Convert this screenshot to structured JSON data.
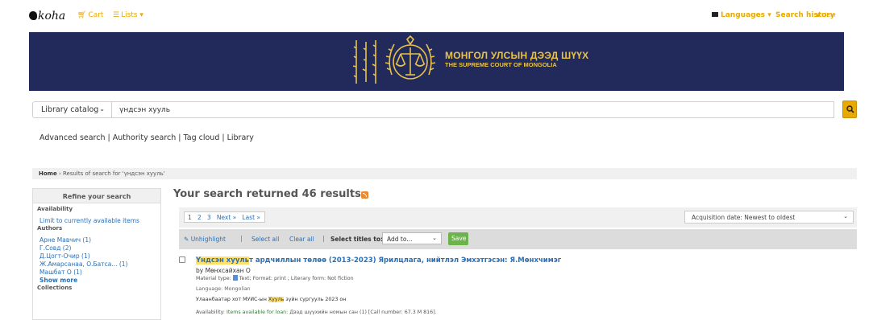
{
  "navbar": {
    "logo": "koha",
    "cart": "Cart",
    "lists": "Lists",
    "languages": "Languages",
    "search_history": "Search history",
    "clear": "Clear"
  },
  "banner": {
    "title": "МОНГОЛ УЛСЫН ДЭЭД ШҮҮХ",
    "subtitle": "THE SUPREME COURT OF MONGOLIA",
    "bg_color": "#222a5c",
    "text_color": "#e8c24a"
  },
  "search": {
    "scope": "Library catalog",
    "query": "үндсэн хууль"
  },
  "links": "Advanced search | Authority search | Tag cloud | Library",
  "breadcrumb": {
    "home": "Home",
    "current": "Results of search for 'үндсэн хууль'"
  },
  "refine": {
    "title": "Refine your search",
    "availability_title": "Availability",
    "availability_link": "Limit to currently available items",
    "authors_title": "Authors",
    "authors": [
      "Арне Мавчич (1)",
      "Г.Совд (2)",
      "Д.Цогт-Очир (1)",
      "Ж.Амарсанаа, О.Батса... (1)",
      "Машбат О (1)"
    ],
    "show_more": "Show more",
    "collections_title": "Collections"
  },
  "results": {
    "heading": "Your search returned 46 results.",
    "pages": [
      "1",
      "2",
      "3",
      "Next »",
      "Last »"
    ],
    "sort": "Acquisition date: Newest to oldest",
    "toolbar": {
      "unhighlight": "Unhighlight",
      "select_all": "Select all",
      "clear_all": "Clear all",
      "select_titles": "Select titles to:",
      "add_to": "Add to...",
      "save": "Save"
    },
    "record": {
      "title_hl": "Үндсэн хууль",
      "title_rest": "т ардчиллын төлөө (2013-2023) Ярилцлага, нийтлэл Эмхэтгэсэн: Я.Мөнхчимэг",
      "author": "by Мөнхсайхан О",
      "material": "Material type:",
      "material_type": "Text;",
      "format": "Format: print ;",
      "literary": "Literary form: Not fiction",
      "language": "Language: Mongolian",
      "pub_before": "Улаанбаатар хот МУИС-ын",
      "pub_hl": "Хууль",
      "pub_after": "зүйн сургууль 2023 он",
      "avail_label": "Availability:",
      "avail_value": "Items available for loan:",
      "avail_rest": "Дээд шүүхийн номын сан (1) [Call number: 67.3 М 816]."
    }
  }
}
